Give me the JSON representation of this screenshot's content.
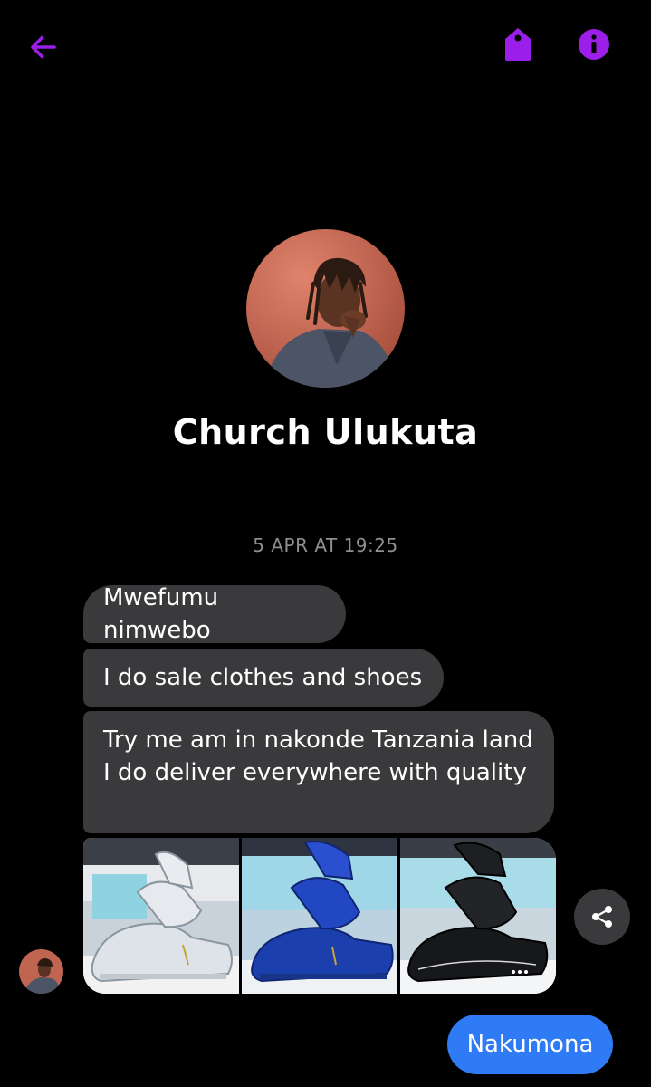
{
  "header": {
    "back_icon": "arrow-left-icon",
    "tag_icon": "tag-icon",
    "info_icon": "info-icon",
    "accent_color": "#9b1fe8"
  },
  "profile": {
    "name": "Church Ulukuta",
    "avatar_icon": "profile-photo"
  },
  "conversation": {
    "timestamp": "5 APR AT 19:25",
    "incoming": [
      {
        "text": "Mwefumu nimwebo"
      },
      {
        "text": "I do sale clothes and shoes"
      },
      {
        "text": "Try me am in nakonde Tanzania land I do deliver everywhere with quality"
      }
    ],
    "photos": [
      {
        "subject": "white sneaker"
      },
      {
        "subject": "blue sneaker"
      },
      {
        "subject": "black sneaker"
      }
    ],
    "share_icon": "share-icon",
    "outgoing": [
      {
        "text": "Nakumona"
      }
    ],
    "colors": {
      "incoming_bubble": "#3a3a3c",
      "outgoing_bubble": "#2f7bf5",
      "timestamp": "#8e8e93"
    }
  }
}
